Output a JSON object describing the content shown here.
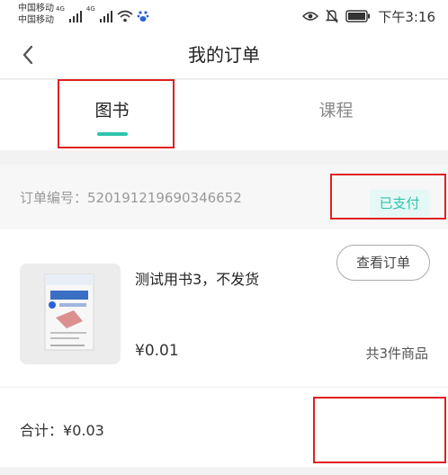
{
  "status_bar": {
    "carrier1": "中国移动",
    "carrier2": "中国移动",
    "net1": "4G",
    "net2": "4G",
    "time": "下午3:16"
  },
  "nav": {
    "title": "我的订单"
  },
  "tabs": [
    {
      "label": "图书",
      "active": true
    },
    {
      "label": "课程",
      "active": false
    }
  ],
  "order": {
    "number_label": "订单编号：",
    "number": "520191219690346652",
    "status": "已支付",
    "item": {
      "title": "测试用书3，不发货",
      "price": "¥0.01",
      "count": "共3件商品"
    },
    "total_label": "合计：",
    "total": "¥0.03",
    "view_button": "查看订单"
  },
  "colors": {
    "accent": "#2fc3ad",
    "highlight": "#e02020"
  }
}
